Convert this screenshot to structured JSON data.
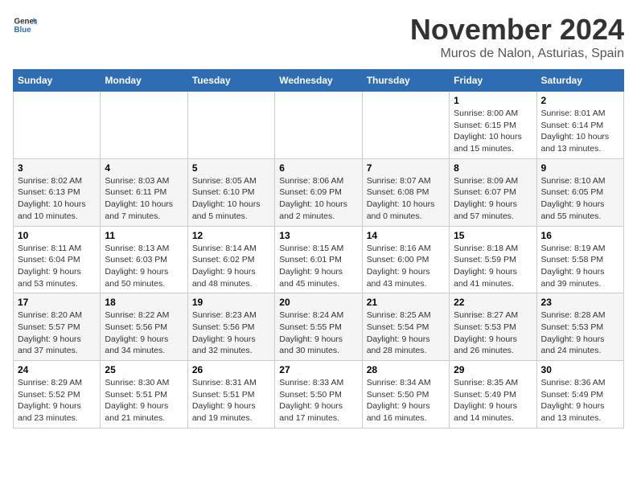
{
  "logo": {
    "general": "General",
    "blue": "Blue"
  },
  "title": "November 2024",
  "location": "Muros de Nalon, Asturias, Spain",
  "headers": [
    "Sunday",
    "Monday",
    "Tuesday",
    "Wednesday",
    "Thursday",
    "Friday",
    "Saturday"
  ],
  "weeks": [
    [
      {
        "day": "",
        "info": ""
      },
      {
        "day": "",
        "info": ""
      },
      {
        "day": "",
        "info": ""
      },
      {
        "day": "",
        "info": ""
      },
      {
        "day": "",
        "info": ""
      },
      {
        "day": "1",
        "info": "Sunrise: 8:00 AM\nSunset: 6:15 PM\nDaylight: 10 hours and 15 minutes."
      },
      {
        "day": "2",
        "info": "Sunrise: 8:01 AM\nSunset: 6:14 PM\nDaylight: 10 hours and 13 minutes."
      }
    ],
    [
      {
        "day": "3",
        "info": "Sunrise: 8:02 AM\nSunset: 6:13 PM\nDaylight: 10 hours and 10 minutes."
      },
      {
        "day": "4",
        "info": "Sunrise: 8:03 AM\nSunset: 6:11 PM\nDaylight: 10 hours and 7 minutes."
      },
      {
        "day": "5",
        "info": "Sunrise: 8:05 AM\nSunset: 6:10 PM\nDaylight: 10 hours and 5 minutes."
      },
      {
        "day": "6",
        "info": "Sunrise: 8:06 AM\nSunset: 6:09 PM\nDaylight: 10 hours and 2 minutes."
      },
      {
        "day": "7",
        "info": "Sunrise: 8:07 AM\nSunset: 6:08 PM\nDaylight: 10 hours and 0 minutes."
      },
      {
        "day": "8",
        "info": "Sunrise: 8:09 AM\nSunset: 6:07 PM\nDaylight: 9 hours and 57 minutes."
      },
      {
        "day": "9",
        "info": "Sunrise: 8:10 AM\nSunset: 6:05 PM\nDaylight: 9 hours and 55 minutes."
      }
    ],
    [
      {
        "day": "10",
        "info": "Sunrise: 8:11 AM\nSunset: 6:04 PM\nDaylight: 9 hours and 53 minutes."
      },
      {
        "day": "11",
        "info": "Sunrise: 8:13 AM\nSunset: 6:03 PM\nDaylight: 9 hours and 50 minutes."
      },
      {
        "day": "12",
        "info": "Sunrise: 8:14 AM\nSunset: 6:02 PM\nDaylight: 9 hours and 48 minutes."
      },
      {
        "day": "13",
        "info": "Sunrise: 8:15 AM\nSunset: 6:01 PM\nDaylight: 9 hours and 45 minutes."
      },
      {
        "day": "14",
        "info": "Sunrise: 8:16 AM\nSunset: 6:00 PM\nDaylight: 9 hours and 43 minutes."
      },
      {
        "day": "15",
        "info": "Sunrise: 8:18 AM\nSunset: 5:59 PM\nDaylight: 9 hours and 41 minutes."
      },
      {
        "day": "16",
        "info": "Sunrise: 8:19 AM\nSunset: 5:58 PM\nDaylight: 9 hours and 39 minutes."
      }
    ],
    [
      {
        "day": "17",
        "info": "Sunrise: 8:20 AM\nSunset: 5:57 PM\nDaylight: 9 hours and 37 minutes."
      },
      {
        "day": "18",
        "info": "Sunrise: 8:22 AM\nSunset: 5:56 PM\nDaylight: 9 hours and 34 minutes."
      },
      {
        "day": "19",
        "info": "Sunrise: 8:23 AM\nSunset: 5:56 PM\nDaylight: 9 hours and 32 minutes."
      },
      {
        "day": "20",
        "info": "Sunrise: 8:24 AM\nSunset: 5:55 PM\nDaylight: 9 hours and 30 minutes."
      },
      {
        "day": "21",
        "info": "Sunrise: 8:25 AM\nSunset: 5:54 PM\nDaylight: 9 hours and 28 minutes."
      },
      {
        "day": "22",
        "info": "Sunrise: 8:27 AM\nSunset: 5:53 PM\nDaylight: 9 hours and 26 minutes."
      },
      {
        "day": "23",
        "info": "Sunrise: 8:28 AM\nSunset: 5:53 PM\nDaylight: 9 hours and 24 minutes."
      }
    ],
    [
      {
        "day": "24",
        "info": "Sunrise: 8:29 AM\nSunset: 5:52 PM\nDaylight: 9 hours and 23 minutes."
      },
      {
        "day": "25",
        "info": "Sunrise: 8:30 AM\nSunset: 5:51 PM\nDaylight: 9 hours and 21 minutes."
      },
      {
        "day": "26",
        "info": "Sunrise: 8:31 AM\nSunset: 5:51 PM\nDaylight: 9 hours and 19 minutes."
      },
      {
        "day": "27",
        "info": "Sunrise: 8:33 AM\nSunset: 5:50 PM\nDaylight: 9 hours and 17 minutes."
      },
      {
        "day": "28",
        "info": "Sunrise: 8:34 AM\nSunset: 5:50 PM\nDaylight: 9 hours and 16 minutes."
      },
      {
        "day": "29",
        "info": "Sunrise: 8:35 AM\nSunset: 5:49 PM\nDaylight: 9 hours and 14 minutes."
      },
      {
        "day": "30",
        "info": "Sunrise: 8:36 AM\nSunset: 5:49 PM\nDaylight: 9 hours and 13 minutes."
      }
    ]
  ]
}
